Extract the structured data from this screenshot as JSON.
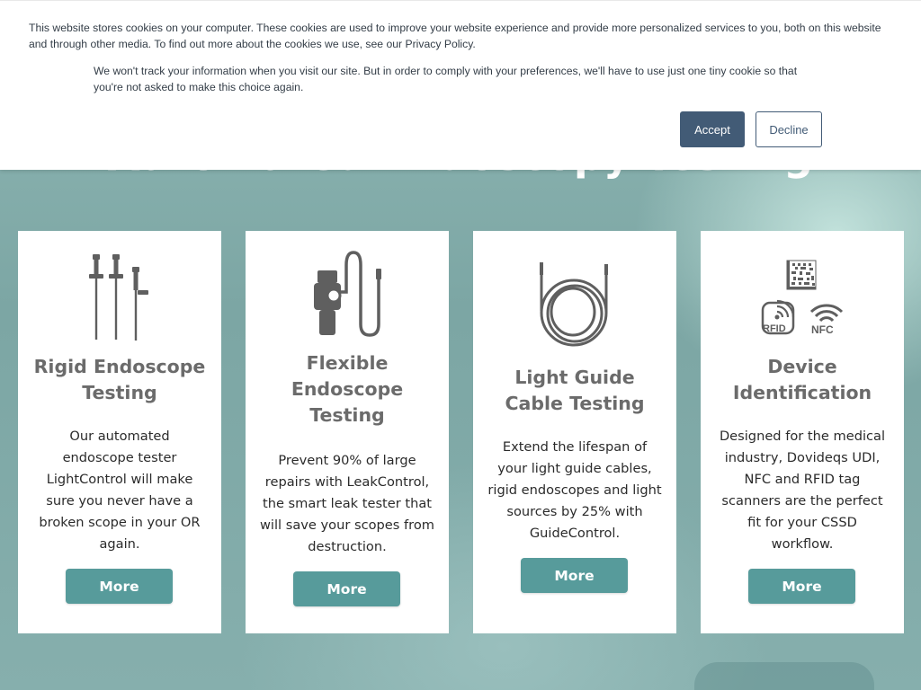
{
  "cookie_banner": {
    "text": "This website stores cookies on your computer. These cookies are used to improve your website experience and provide more personalized services to you, both on this website and through other media. To find out more about the cookies we use, see our Privacy Policy.",
    "preference_text": "We won't track your information when you visit our site. But in order to comply with your preferences, we'll have to use just one tiny cookie so that you're not asked to make this choice again.",
    "accept_label": "Accept",
    "decline_label": "Decline",
    "accent_color": "#425b76"
  },
  "hero": {
    "title": "Automated Endoscopy Testing"
  },
  "cards": [
    {
      "icon": "rigid-endoscope-icon",
      "title": "Rigid Endoscope Testing",
      "description": "Our automated endoscope tester LightControl will make sure you never have a broken scope in your OR again.",
      "button_label": "More"
    },
    {
      "icon": "flexible-endoscope-icon",
      "title": "Flexible Endoscope Testing",
      "description": "Prevent 90% of large repairs with LeakControl, the smart leak tester that will save  your scopes from destruction.",
      "button_label": "More"
    },
    {
      "icon": "light-guide-cable-icon",
      "title": "Light Guide Cable Testing",
      "description": "Extend the lifespan of your light guide cables, rigid endoscopes and light sources by 25% with GuideControl.",
      "button_label": "More"
    },
    {
      "icon": "device-identification-icon",
      "title": "Device Identification",
      "description": "Designed for the medical industry, Dovideqs UDI, NFC and RFID tag scanners are the perfect fit for your CSSD workflow.",
      "button_label": "More",
      "icon_labels": {
        "rfid": "RFID",
        "nfc": "NFC"
      }
    }
  ],
  "colors": {
    "button": "#579b9b",
    "title_text": "#6b6b6b",
    "icon_gray": "#5f5f5f"
  }
}
